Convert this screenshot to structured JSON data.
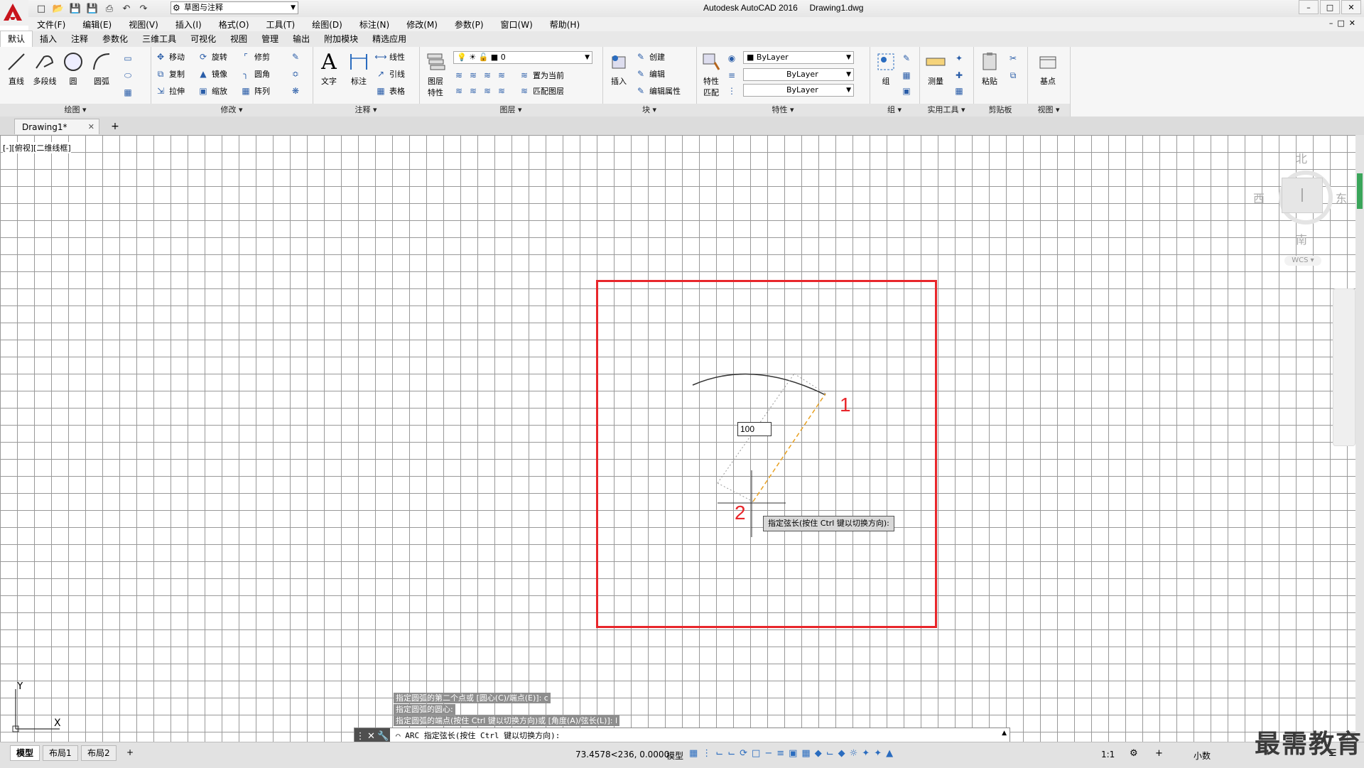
{
  "titlebar": {
    "app_title": "Autodesk AutoCAD 2016",
    "file_name": "Drawing1.dwg",
    "workspace": "草图与注释"
  },
  "menubar": [
    "文件(F)",
    "编辑(E)",
    "视图(V)",
    "插入(I)",
    "格式(O)",
    "工具(T)",
    "绘图(D)",
    "标注(N)",
    "修改(M)",
    "参数(P)",
    "窗口(W)",
    "帮助(H)"
  ],
  "ribbon_tabs": [
    "默认",
    "插入",
    "注释",
    "参数化",
    "三维工具",
    "可视化",
    "视图",
    "管理",
    "输出",
    "附加模块",
    "精选应用"
  ],
  "ribbon": {
    "draw": {
      "title": "绘图",
      "line": "直线",
      "polyline": "多段线",
      "circle": "圆",
      "arc": "圆弧"
    },
    "modify": {
      "title": "修改",
      "move": "移动",
      "rotate": "旋转",
      "trim": "修剪",
      "copy": "复制",
      "mirror": "镜像",
      "fillet": "圆角",
      "stretch": "拉伸",
      "scale": "缩放",
      "array": "阵列"
    },
    "annotation": {
      "title": "注释",
      "text": "文字",
      "dimension": "标注",
      "linear": "线性",
      "leader": "引线",
      "table": "表格"
    },
    "layers": {
      "title": "图层",
      "layer_props": "图层\n特性",
      "layer_props_line1": "图层",
      "layer_props_line2": "特性",
      "current_layer": "0",
      "make_current": "置为当前",
      "match_layer": "匹配图层"
    },
    "block": {
      "title": "块",
      "insert": "插入",
      "create": "创建",
      "edit": "编辑",
      "edit_attr": "编辑属性"
    },
    "properties": {
      "title": "特性",
      "match_line1": "特性",
      "match_line2": "匹配",
      "color": "ByLayer",
      "linetype": "ByLayer",
      "lineweight": "ByLayer"
    },
    "groups": {
      "title": "组",
      "group": "组"
    },
    "utilities": {
      "title": "实用工具",
      "measure": "测量"
    },
    "clipboard": {
      "title": "剪贴板",
      "paste": "粘贴"
    },
    "view": {
      "title": "视图",
      "base": "基点"
    }
  },
  "doc_tab": {
    "name": "Drawing1*"
  },
  "viewport": {
    "label": "[-][俯视][二维线框]",
    "viewcube": {
      "north": "北",
      "south": "南",
      "east": "东",
      "west": "西",
      "wcs": "WCS"
    }
  },
  "annotations": {
    "callout_1": "1",
    "callout_2": "2",
    "frame_color": "#e8262b"
  },
  "dynamic_input": {
    "value": "100",
    "tooltip": "指定弦长(按住 Ctrl 键以切换方向):"
  },
  "command": {
    "history": [
      "指定圆弧的第二个点或 [圆心(C)/端点(E)]: c",
      "指定圆弧的圆心:",
      "指定圆弧的端点(按住 Ctrl 键以切换方向)或 [角度(A)/弦长(L)]: l"
    ],
    "prompt": "ARC 指定弦长(按住 Ctrl 键以切换方向):"
  },
  "ucs": {
    "x": "X",
    "y": "Y"
  },
  "layout_tabs": [
    "模型",
    "布局1",
    "布局2"
  ],
  "statusbar": {
    "coords": "73.4578<236, 0.0000",
    "space": "模型",
    "scale": "1:1",
    "units": "小数"
  },
  "watermark": "最需教育"
}
